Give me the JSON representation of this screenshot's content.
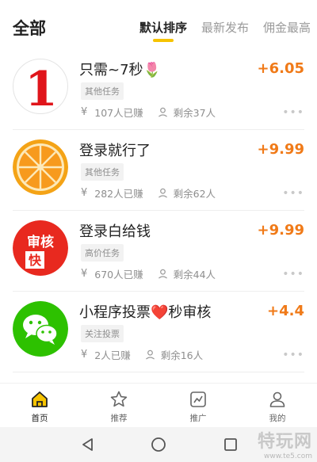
{
  "header": {
    "title": "全部",
    "tabs": [
      {
        "label": "默认排序",
        "active": true
      },
      {
        "label": "最新发布",
        "active": false
      },
      {
        "label": "佣金最高",
        "active": false
      }
    ]
  },
  "colors": {
    "accent": "#f6c300",
    "price": "#f07a18",
    "muted": "#8e8e8e"
  },
  "tasks": [
    {
      "name": "只需~7秒🌷",
      "price": "+6.05",
      "tag": "其他任务",
      "earned": "107人已赚",
      "remaining": "剩余37人",
      "thumb": "number-1",
      "thumb_text": "1"
    },
    {
      "name": "登录就行了",
      "price": "+9.99",
      "tag": "其他任务",
      "earned": "282人已赚",
      "remaining": "剩余62人",
      "thumb": "orange-slice"
    },
    {
      "name": "登录白给钱",
      "price": "+9.99",
      "tag": "高价任务",
      "earned": "670人已赚",
      "remaining": "剩余44人",
      "thumb": "review-badge",
      "thumb_text_top": "审核",
      "thumb_text_bottom": "快"
    },
    {
      "name": "小程序投票❤️秒审核",
      "price": "+4.4",
      "tag": "关注投票",
      "earned": "2人已赚",
      "remaining": "剩余16人",
      "thumb": "wechat-logo"
    }
  ],
  "meta_icons": {
    "earned": "yen-icon",
    "remaining": "person-icon",
    "more": "more-dots-icon",
    "yen_glyph": "¥",
    "more_glyph": "•••"
  },
  "tabbar": [
    {
      "label": "首页",
      "icon": "home-icon",
      "active": true
    },
    {
      "label": "推荐",
      "icon": "star-icon",
      "active": false
    },
    {
      "label": "推广",
      "icon": "chart-icon",
      "active": false
    },
    {
      "label": "我的",
      "icon": "user-icon",
      "active": false
    }
  ],
  "watermark": {
    "main": "特玩网",
    "sub": "www.te5.com"
  }
}
